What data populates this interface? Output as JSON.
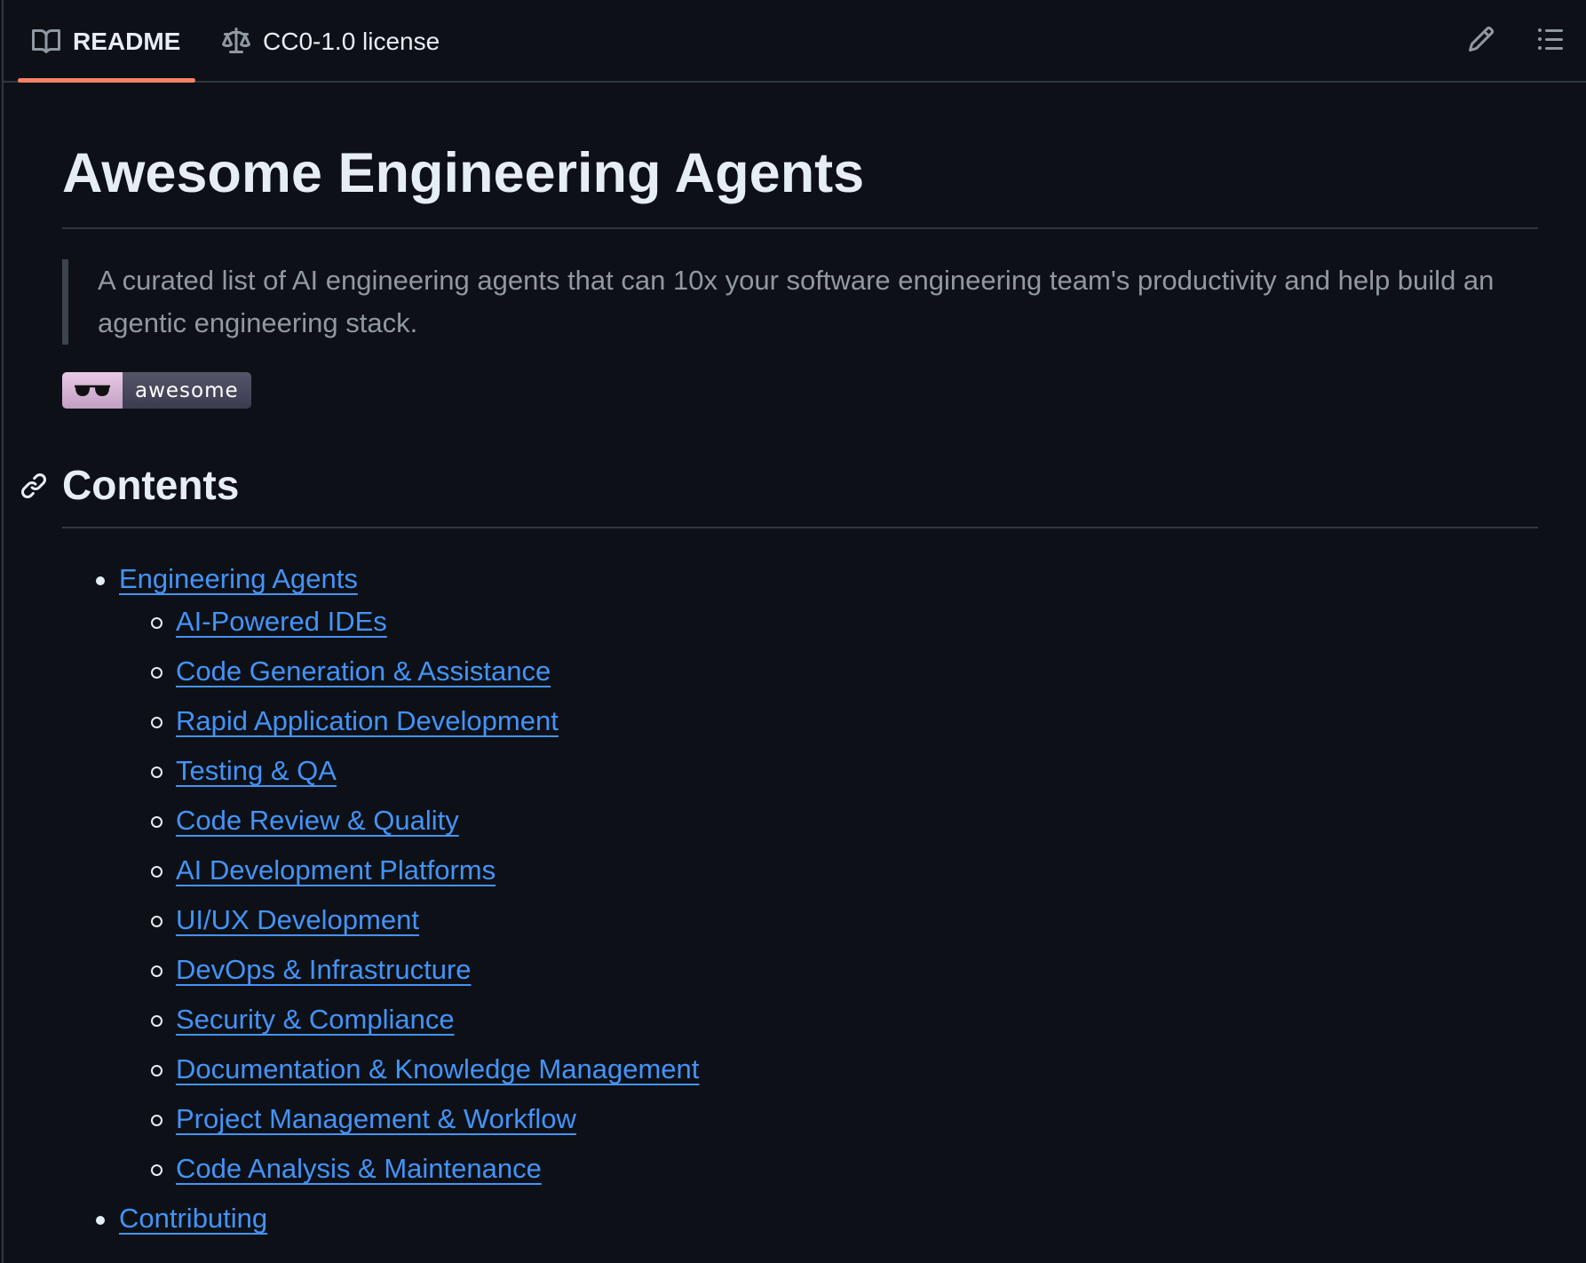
{
  "tabs": {
    "readme_label": "README",
    "license_label": "CC0-1.0 license"
  },
  "readme": {
    "title": "Awesome Engineering Agents",
    "description": "A curated list of AI engineering agents that can 10x your software engineering team's productivity and help build an agentic engineering stack.",
    "badge_text": "awesome",
    "contents_heading": "Contents"
  },
  "toc": {
    "main_label": "Engineering Agents",
    "sub_items": [
      "AI-Powered IDEs",
      "Code Generation & Assistance",
      "Rapid Application Development",
      "Testing & QA",
      "Code Review & Quality",
      "AI Development Platforms",
      "UI/UX Development",
      "DevOps & Infrastructure",
      "Security & Compliance",
      "Documentation & Knowledge Management",
      "Project Management & Workflow",
      "Code Analysis & Maintenance"
    ],
    "last_label": "Contributing"
  },
  "colors": {
    "background": "#0d1117",
    "text": "#e6edf3",
    "muted_text": "#9198a1",
    "link": "#4493f8",
    "border": "#30363d",
    "active_tab_underline": "#f78166"
  }
}
